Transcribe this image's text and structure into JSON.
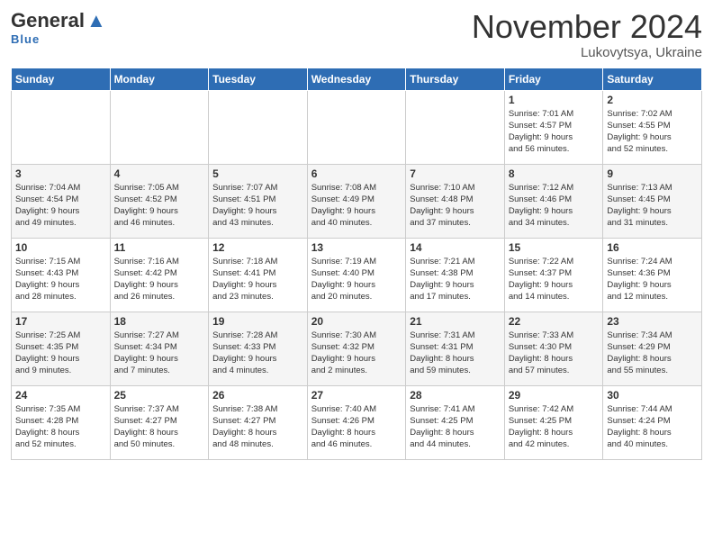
{
  "header": {
    "logo_general": "General",
    "logo_blue": "Blue",
    "month_title": "November 2024",
    "location": "Lukovytsya, Ukraine"
  },
  "days_of_week": [
    "Sunday",
    "Monday",
    "Tuesday",
    "Wednesday",
    "Thursday",
    "Friday",
    "Saturday"
  ],
  "weeks": [
    [
      {
        "day": "",
        "info": ""
      },
      {
        "day": "",
        "info": ""
      },
      {
        "day": "",
        "info": ""
      },
      {
        "day": "",
        "info": ""
      },
      {
        "day": "",
        "info": ""
      },
      {
        "day": "1",
        "info": "Sunrise: 7:01 AM\nSunset: 4:57 PM\nDaylight: 9 hours\nand 56 minutes."
      },
      {
        "day": "2",
        "info": "Sunrise: 7:02 AM\nSunset: 4:55 PM\nDaylight: 9 hours\nand 52 minutes."
      }
    ],
    [
      {
        "day": "3",
        "info": "Sunrise: 7:04 AM\nSunset: 4:54 PM\nDaylight: 9 hours\nand 49 minutes."
      },
      {
        "day": "4",
        "info": "Sunrise: 7:05 AM\nSunset: 4:52 PM\nDaylight: 9 hours\nand 46 minutes."
      },
      {
        "day": "5",
        "info": "Sunrise: 7:07 AM\nSunset: 4:51 PM\nDaylight: 9 hours\nand 43 minutes."
      },
      {
        "day": "6",
        "info": "Sunrise: 7:08 AM\nSunset: 4:49 PM\nDaylight: 9 hours\nand 40 minutes."
      },
      {
        "day": "7",
        "info": "Sunrise: 7:10 AM\nSunset: 4:48 PM\nDaylight: 9 hours\nand 37 minutes."
      },
      {
        "day": "8",
        "info": "Sunrise: 7:12 AM\nSunset: 4:46 PM\nDaylight: 9 hours\nand 34 minutes."
      },
      {
        "day": "9",
        "info": "Sunrise: 7:13 AM\nSunset: 4:45 PM\nDaylight: 9 hours\nand 31 minutes."
      }
    ],
    [
      {
        "day": "10",
        "info": "Sunrise: 7:15 AM\nSunset: 4:43 PM\nDaylight: 9 hours\nand 28 minutes."
      },
      {
        "day": "11",
        "info": "Sunrise: 7:16 AM\nSunset: 4:42 PM\nDaylight: 9 hours\nand 26 minutes."
      },
      {
        "day": "12",
        "info": "Sunrise: 7:18 AM\nSunset: 4:41 PM\nDaylight: 9 hours\nand 23 minutes."
      },
      {
        "day": "13",
        "info": "Sunrise: 7:19 AM\nSunset: 4:40 PM\nDaylight: 9 hours\nand 20 minutes."
      },
      {
        "day": "14",
        "info": "Sunrise: 7:21 AM\nSunset: 4:38 PM\nDaylight: 9 hours\nand 17 minutes."
      },
      {
        "day": "15",
        "info": "Sunrise: 7:22 AM\nSunset: 4:37 PM\nDaylight: 9 hours\nand 14 minutes."
      },
      {
        "day": "16",
        "info": "Sunrise: 7:24 AM\nSunset: 4:36 PM\nDaylight: 9 hours\nand 12 minutes."
      }
    ],
    [
      {
        "day": "17",
        "info": "Sunrise: 7:25 AM\nSunset: 4:35 PM\nDaylight: 9 hours\nand 9 minutes."
      },
      {
        "day": "18",
        "info": "Sunrise: 7:27 AM\nSunset: 4:34 PM\nDaylight: 9 hours\nand 7 minutes."
      },
      {
        "day": "19",
        "info": "Sunrise: 7:28 AM\nSunset: 4:33 PM\nDaylight: 9 hours\nand 4 minutes."
      },
      {
        "day": "20",
        "info": "Sunrise: 7:30 AM\nSunset: 4:32 PM\nDaylight: 9 hours\nand 2 minutes."
      },
      {
        "day": "21",
        "info": "Sunrise: 7:31 AM\nSunset: 4:31 PM\nDaylight: 8 hours\nand 59 minutes."
      },
      {
        "day": "22",
        "info": "Sunrise: 7:33 AM\nSunset: 4:30 PM\nDaylight: 8 hours\nand 57 minutes."
      },
      {
        "day": "23",
        "info": "Sunrise: 7:34 AM\nSunset: 4:29 PM\nDaylight: 8 hours\nand 55 minutes."
      }
    ],
    [
      {
        "day": "24",
        "info": "Sunrise: 7:35 AM\nSunset: 4:28 PM\nDaylight: 8 hours\nand 52 minutes."
      },
      {
        "day": "25",
        "info": "Sunrise: 7:37 AM\nSunset: 4:27 PM\nDaylight: 8 hours\nand 50 minutes."
      },
      {
        "day": "26",
        "info": "Sunrise: 7:38 AM\nSunset: 4:27 PM\nDaylight: 8 hours\nand 48 minutes."
      },
      {
        "day": "27",
        "info": "Sunrise: 7:40 AM\nSunset: 4:26 PM\nDaylight: 8 hours\nand 46 minutes."
      },
      {
        "day": "28",
        "info": "Sunrise: 7:41 AM\nSunset: 4:25 PM\nDaylight: 8 hours\nand 44 minutes."
      },
      {
        "day": "29",
        "info": "Sunrise: 7:42 AM\nSunset: 4:25 PM\nDaylight: 8 hours\nand 42 minutes."
      },
      {
        "day": "30",
        "info": "Sunrise: 7:44 AM\nSunset: 4:24 PM\nDaylight: 8 hours\nand 40 minutes."
      }
    ]
  ]
}
